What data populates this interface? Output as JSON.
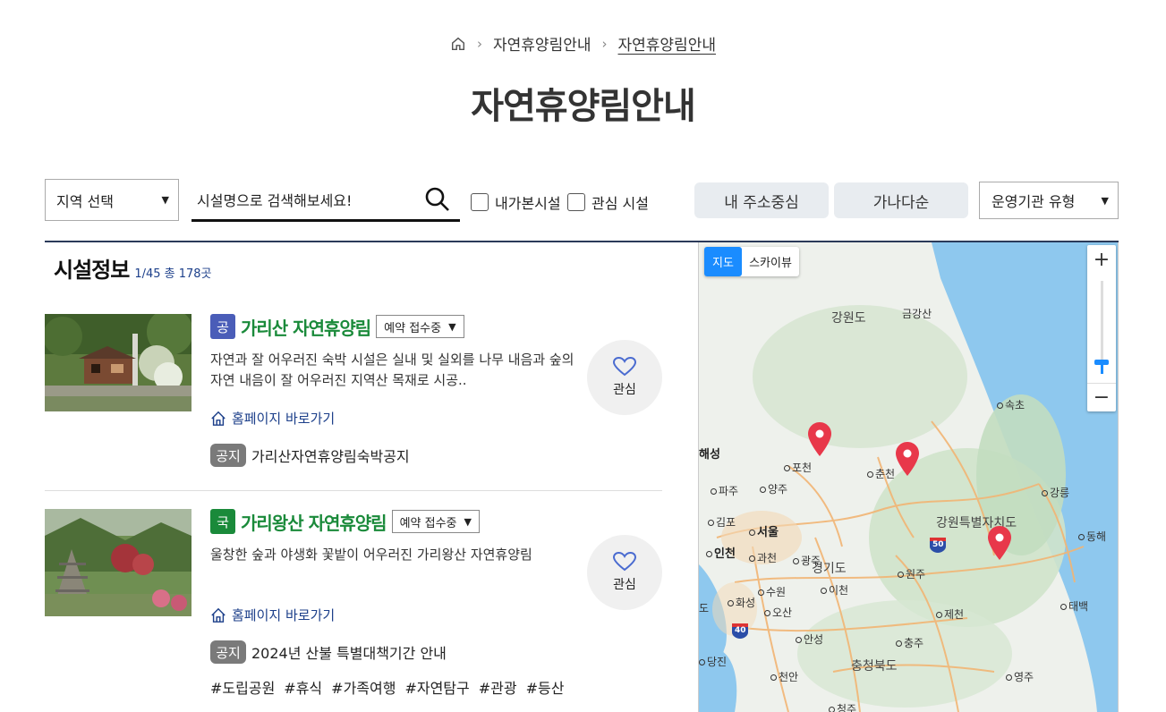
{
  "breadcrumb": {
    "level1": "자연휴양림안내",
    "level2": "자연휴양림안내"
  },
  "page_title": "자연휴양림안내",
  "filters": {
    "region_select": "지역 선택",
    "search_placeholder": "시설명으로 검색해보세요!",
    "checkbox_visited": "내가본시설",
    "checkbox_favorite": "관심 시설",
    "btn_near_me": "내 주소중심",
    "btn_alpha": "가나다순",
    "org_select": "운영기관 유형"
  },
  "list": {
    "title": "시설정보",
    "meta": "1/45 총 178곳",
    "items": [
      {
        "badge": "공",
        "badge_color": "#4a5db8",
        "name": "가리산 자연휴양림",
        "status": "예약 접수중",
        "desc": " 자연과 잘 어우러진 숙박 시설은 실내 및 실외를 나무 내음과 숲의 자연 내음이 잘 어우러진 지역산 목재로 시공..",
        "home_link": "홈페이지 바로가기",
        "notice_tag": "공지",
        "notice": "가리산자연휴양림숙박공지",
        "fav": "관심"
      },
      {
        "badge": "국",
        "badge_color": "#1a8a3a",
        "name": "가리왕산 자연휴양림",
        "status": "예약 접수중",
        "desc": "울창한 숲과 야생화 꽃밭이 어우러진 가리왕산 자연휴양림",
        "home_link": "홈페이지 바로가기",
        "notice_tag": "공지",
        "notice": "2024년 산불 특별대책기간 안내",
        "fav": "관심",
        "tags": [
          "#도립공원",
          "#휴식",
          "#가족여행",
          "#자연탐구",
          "#관광",
          "#등산"
        ]
      }
    ]
  },
  "map": {
    "type_map": "지도",
    "type_sky": "스카이뷰",
    "zoom_in": "+",
    "zoom_out": "−",
    "labels": {
      "gangwon": "강원도",
      "geumgang": "금강산",
      "sokcho": "속초",
      "haeseong": "해성",
      "pocheon": "포천",
      "chuncheon": "춘천",
      "paju": "파주",
      "yangju": "양주",
      "gangneung": "강릉",
      "gimpo": "김포",
      "seoul": "서울",
      "gangwon_special": "강원특별자치도",
      "donghae": "동해",
      "incheon": "인천",
      "gwacheon": "과천",
      "gwangju": "광주",
      "gyeonggi": "경기도",
      "wonju": "원주",
      "suwon": "수원",
      "icheon": "이천",
      "hwaseong": "화성",
      "do": "도",
      "osan": "오산",
      "jecheon": "제천",
      "taebaek": "태백",
      "anseong": "안성",
      "chungju": "충주",
      "dangjin": "당진",
      "chungbuk": "충청북도",
      "cheonan": "천안",
      "yeongju": "영주",
      "cheongju": "청주",
      "hwy50": "50",
      "hwy40": "40"
    }
  }
}
